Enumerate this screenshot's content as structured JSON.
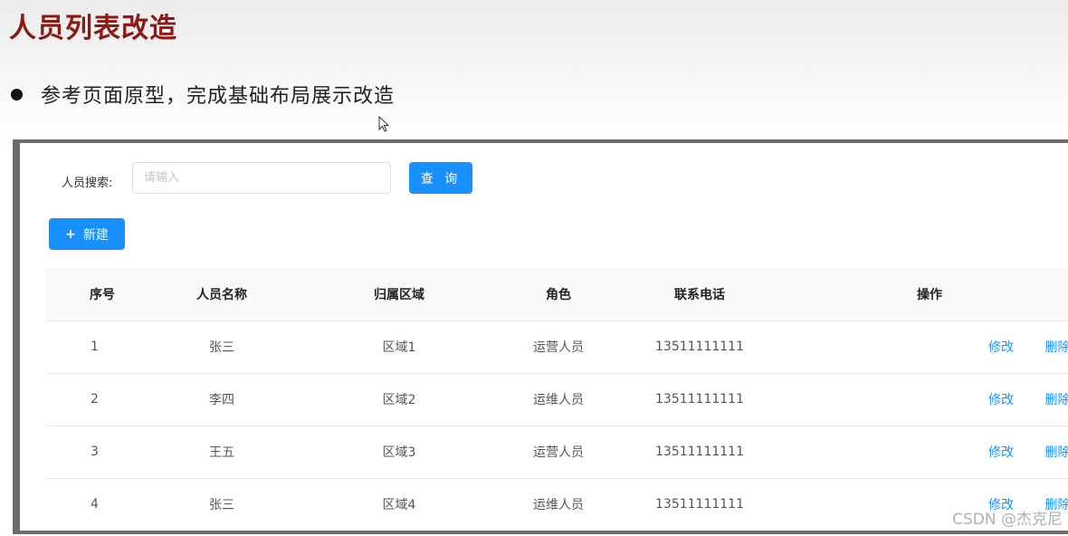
{
  "slide": {
    "title": "人员列表改造",
    "bullet": "参考页面原型，完成基础布局展示改造"
  },
  "search": {
    "label": "人员搜索:",
    "placeholder": "请输入",
    "value": "",
    "query_label": "查 询"
  },
  "toolbar": {
    "new_label": "新建",
    "new_icon": "+"
  },
  "table": {
    "headers": {
      "index": "序号",
      "name": "人员名称",
      "region": "归属区域",
      "role": "角色",
      "phone": "联系电话",
      "ops": "操作"
    },
    "edit_label": "修改",
    "delete_label": "删除",
    "rows": [
      {
        "index": "1",
        "name": "张三",
        "region": "区域1",
        "role": "运营人员",
        "phone": "13511111111"
      },
      {
        "index": "2",
        "name": "李四",
        "region": "区域2",
        "role": "运维人员",
        "phone": "13511111111"
      },
      {
        "index": "3",
        "name": "王五",
        "region": "区域3",
        "role": "运营人员",
        "phone": "13511111111"
      },
      {
        "index": "4",
        "name": "张三",
        "region": "区域4",
        "role": "运维人员",
        "phone": "13511111111"
      }
    ]
  },
  "watermark": "CSDN @杰克尼",
  "colors": {
    "title": "#8b1a14",
    "primary": "#1890ff",
    "frame": "#6c6c6c"
  },
  "icons": {
    "bullet": "bullet-dot-icon",
    "cursor": "mouse-pointer-icon",
    "plus": "plus-icon"
  }
}
